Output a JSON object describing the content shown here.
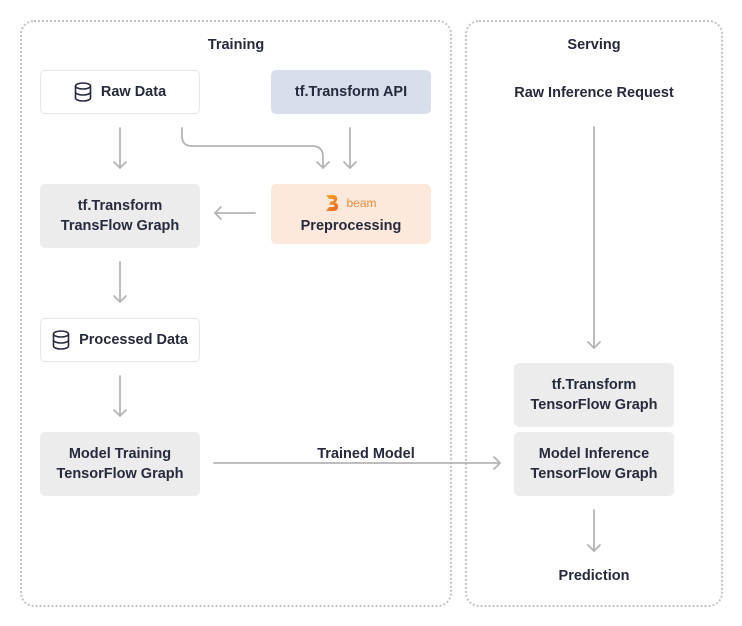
{
  "training": {
    "title": "Training",
    "raw_data": "Raw Data",
    "tf_transform_api": "tf.Transform API",
    "beam_brand": "beam",
    "preprocessing": "Preprocessing",
    "transflow_graph": [
      "tf.Transform",
      "TransFlow Graph"
    ],
    "processed_data": "Processed Data",
    "model_training": [
      "Model Training",
      "TensorFlow Graph"
    ]
  },
  "edge_labels": {
    "trained_model": "Trained Model"
  },
  "serving": {
    "title": "Serving",
    "raw_inference_request": "Raw Inference Request",
    "tf_transform_graph": [
      "tf.Transform",
      "TensorFlow Graph"
    ],
    "model_inference": [
      "Model Inference",
      "TensorFlow Graph"
    ],
    "prediction": "Prediction"
  },
  "colors": {
    "text": "#262a3d",
    "arrow": "#b5b5b5",
    "grey_node": "#ececec",
    "api_node": "#d8deeb",
    "beam_node": "#fde9dc",
    "beam_accent": "#f08a3c"
  },
  "icons": {
    "database": "database-icon",
    "beam": "apache-beam-logo"
  }
}
